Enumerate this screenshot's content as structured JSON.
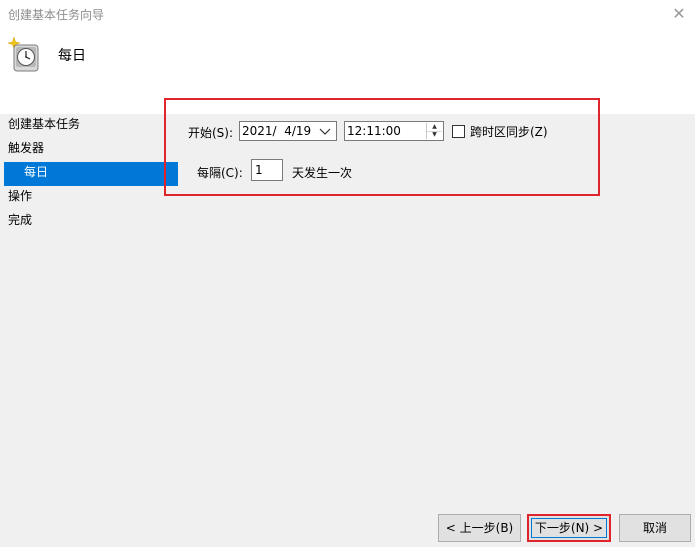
{
  "window": {
    "title": "创建基本任务向导",
    "close_glyph": "✕"
  },
  "header": {
    "title": "每日",
    "icon": "clock-icon"
  },
  "nav": {
    "items": [
      {
        "label": "创建基本任务",
        "selected": false
      },
      {
        "label": "触发器",
        "selected": false
      },
      {
        "label": "每日",
        "selected": true
      },
      {
        "label": "操作",
        "selected": false
      },
      {
        "label": "完成",
        "selected": false
      }
    ]
  },
  "form": {
    "start_label": "开始(S):",
    "date_value": "2021/  4/19",
    "time_value": "12:11:00",
    "sync_timezones_label": "跨时区同步(Z)",
    "sync_timezones_checked": false,
    "recur_label": "每隔(C):",
    "recur_value": "1",
    "recur_suffix": "天发生一次"
  },
  "buttons": {
    "prev_label": "< 上一步(B)",
    "next_label": "下一步(N) >",
    "cancel_label": "取消"
  },
  "colors": {
    "selection": "#0078d7",
    "annotation": "#e0242c"
  }
}
